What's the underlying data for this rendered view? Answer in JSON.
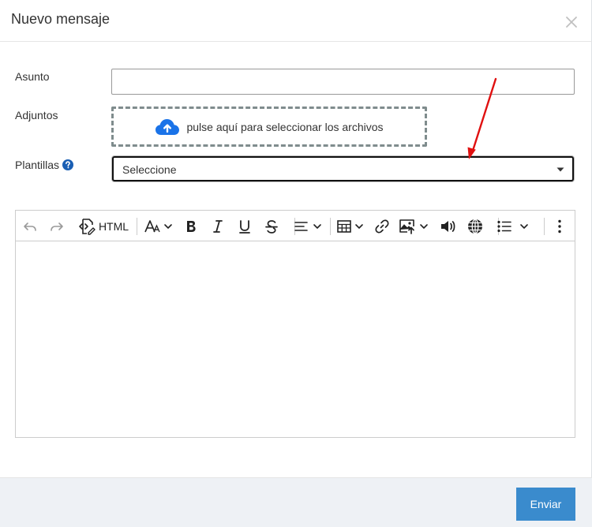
{
  "modal": {
    "title": "Nuevo mensaje",
    "close_icon": "close-icon"
  },
  "form": {
    "subject_label": "Asunto",
    "subject_value": "",
    "attachments_label": "Adjuntos",
    "dropzone_text": "pulse aquí para seleccionar los archivos",
    "templates_label": "Plantillas",
    "templates_selected": "Seleccione"
  },
  "editor": {
    "toolbar": {
      "html_label": "HTML",
      "icons": [
        "undo-icon",
        "redo-icon",
        "code-view-icon",
        "font-size-icon",
        "bold-icon",
        "italic-icon",
        "underline-icon",
        "strikethrough-icon",
        "align-icon",
        "table-icon",
        "link-icon",
        "image-icon",
        "audio-icon",
        "globe-icon",
        "list-icon",
        "more-icon"
      ]
    },
    "content": ""
  },
  "footer": {
    "send_label": "Enviar"
  },
  "colors": {
    "accent": "#3a8bcd",
    "upload_icon": "#1a73e8",
    "help_icon": "#1a5fb4",
    "annotation_arrow": "#e01010",
    "footer_bg": "#eef1f5"
  }
}
